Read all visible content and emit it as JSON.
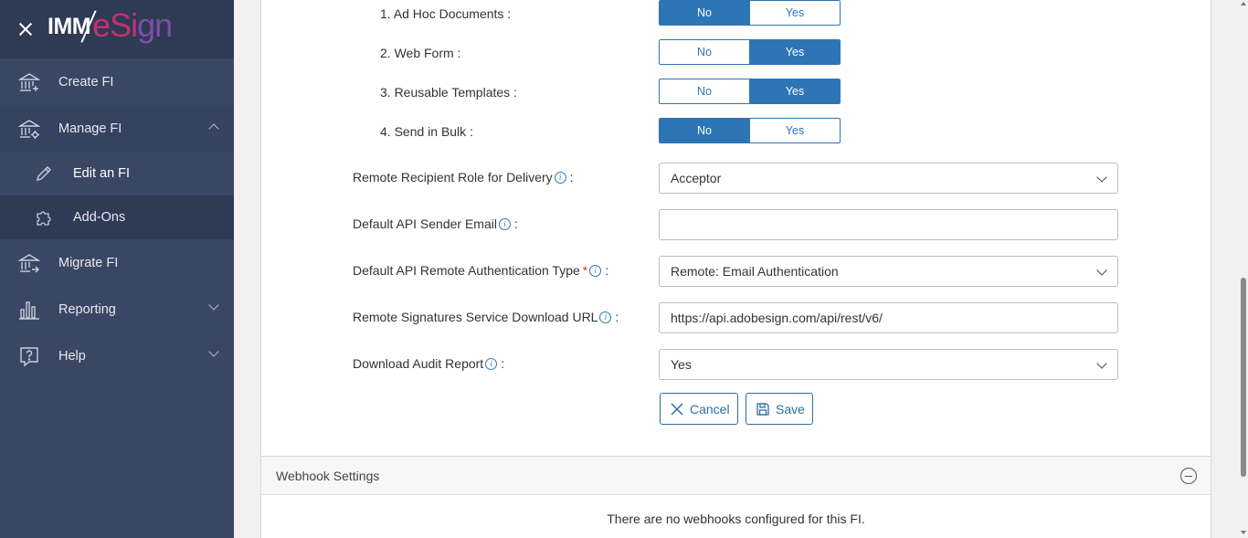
{
  "brand": {
    "logo_part1": "IMM",
    "logo_part2_e": "eSi",
    "logo_part2_g": "gn"
  },
  "sidebar": {
    "items": [
      {
        "label": "Create FI",
        "icon": "bank-add-icon"
      },
      {
        "label": "Manage FI",
        "icon": "bank-gear-icon",
        "expanded": true
      },
      {
        "label": "Edit an FI",
        "icon": "pencil-icon",
        "sub": true,
        "current": true
      },
      {
        "label": "Add-Ons",
        "icon": "puzzle-icon",
        "sub": true
      },
      {
        "label": "Migrate FI",
        "icon": "bank-arrow-icon"
      },
      {
        "label": "Reporting",
        "icon": "bar-chart-icon",
        "expanded": false
      },
      {
        "label": "Help",
        "icon": "help-chat-icon",
        "expanded": false
      }
    ]
  },
  "form": {
    "toggles": [
      {
        "label": "1. Ad Hoc Documents :",
        "no": "No",
        "yes": "Yes",
        "selected": "No"
      },
      {
        "label": "2. Web Form :",
        "no": "No",
        "yes": "Yes",
        "selected": "Yes"
      },
      {
        "label": "3. Reusable Templates :",
        "no": "No",
        "yes": "Yes",
        "selected": "Yes"
      },
      {
        "label": "4. Send in Bulk :",
        "no": "No",
        "yes": "Yes",
        "selected": "No"
      }
    ],
    "remote_role": {
      "label": "Remote Recipient Role for Delivery",
      "suffix": ":",
      "value": "Acceptor"
    },
    "api_sender_email": {
      "label": "Default API Sender Email",
      "suffix": ":",
      "value": ""
    },
    "auth_type": {
      "label": "Default API Remote Authentication Type",
      "required_mark": "*",
      "suffix": ":",
      "value": "Remote: Email Authentication"
    },
    "download_url": {
      "label": "Remote Signatures Service Download URL",
      "suffix": ":",
      "value": "https://api.adobesign.com/api/rest/v6/"
    },
    "audit_report": {
      "label": "Download Audit Report",
      "suffix": ":",
      "value": "Yes"
    },
    "info_glyph": "i",
    "cancel_label": "Cancel",
    "save_label": "Save"
  },
  "webhook": {
    "title": "Webhook Settings",
    "empty_message": "There are no webhooks configured for this FI."
  },
  "colors": {
    "sidebar_bg": "#3a4764",
    "accent": "#2e75b6",
    "required": "#d9363e",
    "logo_e": "#c4306f",
    "logo_g": "#7b4fa8"
  }
}
